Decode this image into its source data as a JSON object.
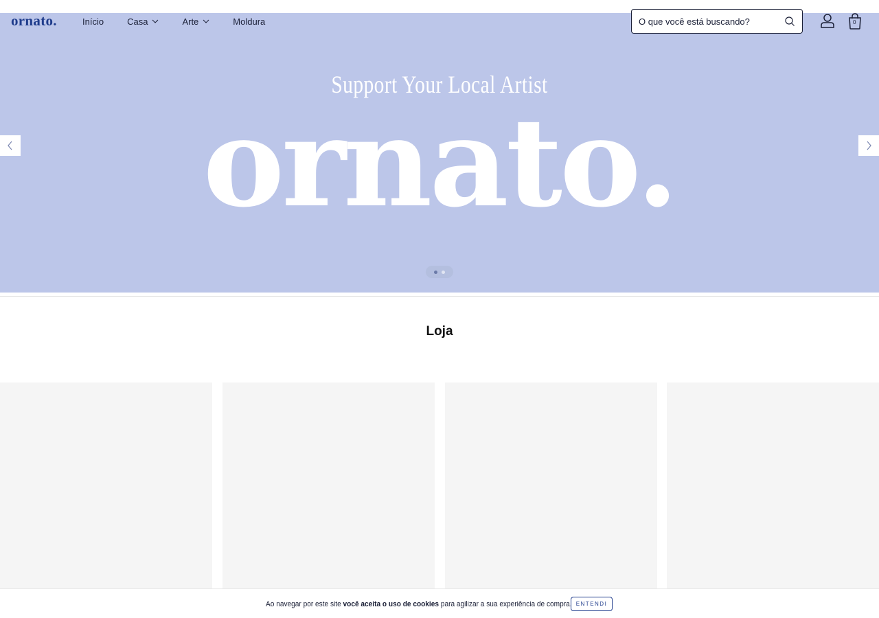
{
  "header": {
    "logo": "ornato.",
    "nav": [
      {
        "label": "Início",
        "has_dropdown": false
      },
      {
        "label": "Casa",
        "has_dropdown": true
      },
      {
        "label": "Arte",
        "has_dropdown": true
      },
      {
        "label": "Moldura",
        "has_dropdown": false
      }
    ],
    "search_placeholder": "O que você está buscando?",
    "cart_count": "0",
    "icons": [
      "search-icon",
      "user-icon",
      "bag-icon",
      "chevron-down-icon"
    ]
  },
  "hero": {
    "subtitle": "Support Your Local Artist",
    "brand": "ornato.",
    "background": "#bcc6e9",
    "slide_count": 2,
    "active_slide": 1
  },
  "shop": {
    "title": "Loja"
  },
  "cookie": {
    "text_before": "Ao navegar por este site ",
    "text_bold": "você aceita o uso de cookies",
    "text_after": " para agilizar a sua experiência de compra.",
    "button_label": "ENTENDI"
  },
  "colors": {
    "brand": "#1f3c8c",
    "text": "#1a1f36",
    "card_placeholder": "#f5f5f5"
  }
}
